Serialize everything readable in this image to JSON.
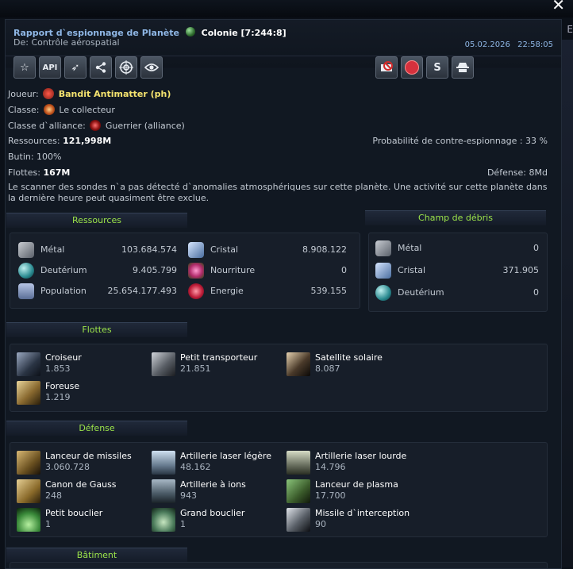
{
  "window": {
    "close_label": "✕",
    "side_fragment": "E"
  },
  "header": {
    "title": "Rapport d`espionnage de Planète",
    "colony": "Colonie [7:244:8]",
    "sender": "De: Contrôle aérospatial",
    "date": "05.02.2026",
    "time": "22:58:05"
  },
  "toolbar": {
    "api_label": "API",
    "s_label": "S",
    "icons": [
      "star-icon",
      "api-icon",
      "attack-icon",
      "share-icon",
      "target-icon",
      "eye-icon",
      "no-message-icon",
      "stop-icon",
      "s-icon",
      "spy-icon"
    ]
  },
  "info": {
    "player_label": "Joueur:",
    "player_value": "Bandit Antimatter (ph)",
    "class_label": "Classe:",
    "class_value": "Le collecteur",
    "alliance_class_label": "Classe d`alliance:",
    "alliance_class_value": "Guerrier (alliance)",
    "resources_label": "Ressources:",
    "resources_value": "121,998M",
    "counter_label": "Probabilité de contre-espionnage : 33 %",
    "loot_label": "Butin: 100%",
    "fleets_label": "Flottes:",
    "fleets_value": "167M",
    "defense_label": "Défense:",
    "defense_value": "8Md",
    "description": "Le scanner des sondes n`a pas détecté d`anomalies atmosphériques sur cette planète. Une activité sur cette planète dans la dernière heure peut quasiment être exclue."
  },
  "resources": {
    "title": "Ressources",
    "items": [
      {
        "name": "Métal",
        "value": "103.684.574",
        "color": "#8a8f99"
      },
      {
        "name": "Cristal",
        "value": "8.908.122",
        "color": "#86a8d8"
      },
      {
        "name": "Deutérium",
        "value": "9.405.799",
        "color": "#3f9aa0"
      },
      {
        "name": "Nourriture",
        "value": "0",
        "color": "#c64a8a"
      },
      {
        "name": "Population",
        "value": "25.654.177.493",
        "color": "#7a8fb6"
      },
      {
        "name": "Energie",
        "value": "539.155",
        "color": "#d23a5a"
      }
    ]
  },
  "debris": {
    "title": "Champ de débris",
    "items": [
      {
        "name": "Métal",
        "value": "0"
      },
      {
        "name": "Cristal",
        "value": "371.905"
      },
      {
        "name": "Deutérium",
        "value": "0"
      }
    ]
  },
  "fleets": {
    "title": "Flottes",
    "items": [
      {
        "name": "Croiseur",
        "count": "1.853"
      },
      {
        "name": "Petit transporteur",
        "count": "21.851"
      },
      {
        "name": "Satellite solaire",
        "count": "8.087"
      },
      {
        "name": "Foreuse",
        "count": "1.219"
      }
    ]
  },
  "defense": {
    "title": "Défense",
    "items": [
      {
        "name": "Lanceur de missiles",
        "count": "3.060.728"
      },
      {
        "name": "Artillerie laser légère",
        "count": "48.162"
      },
      {
        "name": "Artillerie laser lourde",
        "count": "14.796"
      },
      {
        "name": "Canon de Gauss",
        "count": "248"
      },
      {
        "name": "Artillerie à ions",
        "count": "943"
      },
      {
        "name": "Lanceur de plasma",
        "count": "17.700"
      },
      {
        "name": "Petit bouclier",
        "count": "1"
      },
      {
        "name": "Grand bouclier",
        "count": "1"
      },
      {
        "name": "Missile d`interception",
        "count": "90"
      }
    ]
  },
  "buildings": {
    "title": "Bâtiment"
  }
}
